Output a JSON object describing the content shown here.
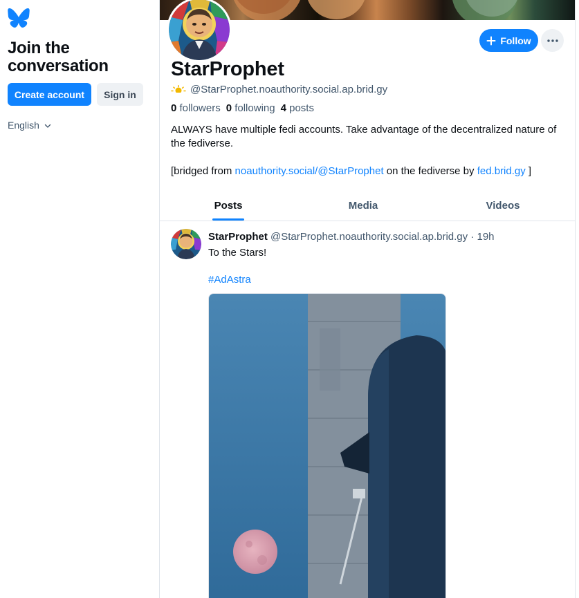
{
  "sidebar": {
    "logo_icon": "butterfly-icon",
    "title": "Join the conversation",
    "create_account_label": "Create account",
    "sign_in_label": "Sign in",
    "language_label": "English"
  },
  "profile": {
    "display_name": "StarProphet",
    "handle": "@StarProphet.noauthority.social.ap.brid.gy",
    "handle_icon": "sun-emoji-icon",
    "follow_label": "Follow",
    "stats": {
      "followers_count": "0",
      "followers_label": "followers",
      "following_count": "0",
      "following_label": "following",
      "posts_count": "4",
      "posts_label": "posts"
    },
    "bio_line1": "ALWAYS have multiple fedi accounts. Take advantage of the decentralized nature of the fediverse.",
    "bridge_prefix": "[bridged from ",
    "bridge_link1": "noauthority.social/@StarProphet",
    "bridge_middle": " on the fediverse by ",
    "bridge_link2": "fed.brid.gy",
    "bridge_suffix": " ]"
  },
  "tabs": [
    {
      "label": "Posts",
      "active": true
    },
    {
      "label": "Media",
      "active": false
    },
    {
      "label": "Videos",
      "active": false
    }
  ],
  "post": {
    "author_name": "StarProphet",
    "author_handle": "@StarProphet.noauthority.social.ap.brid.gy",
    "separator": " · ",
    "time": "19h",
    "text": "To the Stars!",
    "hashtag": "#AdAstra",
    "image_icon": "rocket-moon-photo"
  },
  "colors": {
    "accent": "#1083fe",
    "text_primary": "#0b0f14",
    "text_secondary": "#42576c",
    "border": "#dfe4ea",
    "button_secondary_bg": "#eef1f4"
  }
}
